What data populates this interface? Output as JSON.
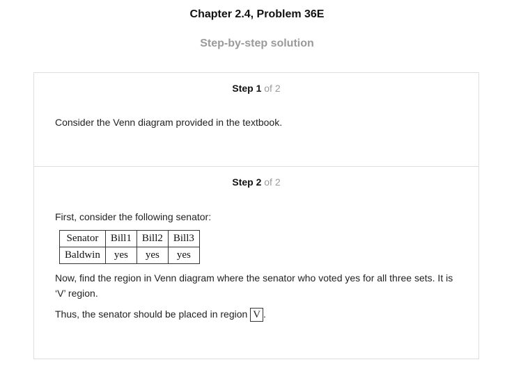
{
  "header": {
    "title": "Chapter 2.4, Problem 36E",
    "subtitle": "Step-by-step solution"
  },
  "steps": [
    {
      "label": "Step 1",
      "of": "of 2",
      "text": "Consider the Venn diagram provided in the textbook."
    },
    {
      "label": "Step 2",
      "of": "of 2",
      "intro": "First, consider the following senator:",
      "table": {
        "headers": [
          "Senator",
          "Bill1",
          "Bill2",
          "Bill3"
        ],
        "row": [
          "Baldwin",
          "yes",
          "yes",
          "yes"
        ]
      },
      "explanation": "Now, find the region in Venn diagram where the senator who voted yes for all three sets. It is ‘V’ region.",
      "conclusion_prefix": "Thus, the senator should be placed in region",
      "answer": "V",
      "conclusion_suffix": "."
    }
  ]
}
